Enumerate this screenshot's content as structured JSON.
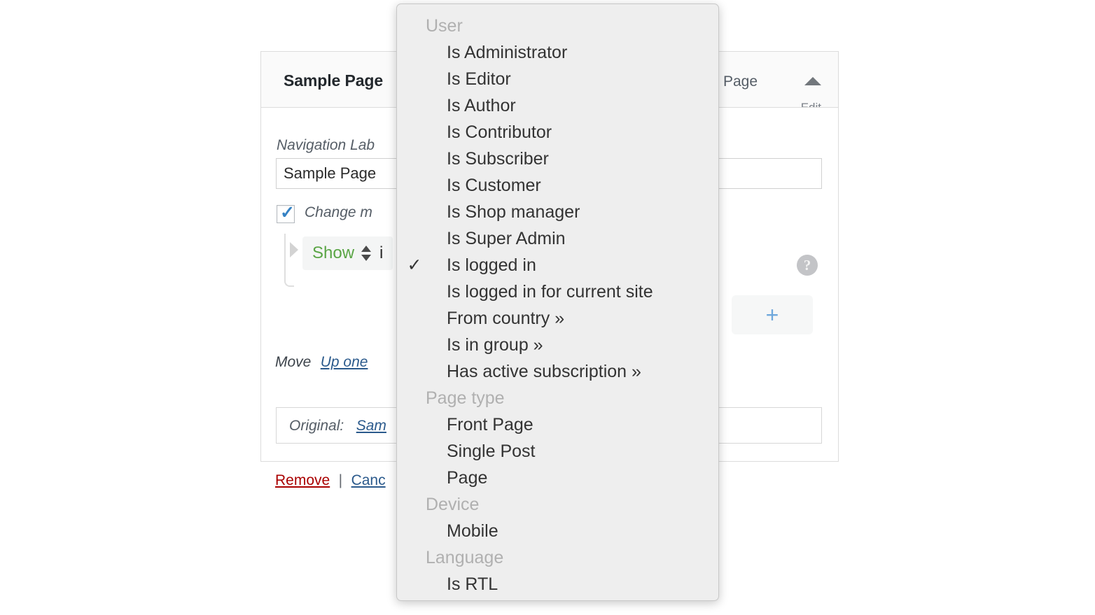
{
  "panel": {
    "header": {
      "title": "Sample Page",
      "type_label": "Page",
      "toggle_icon": "triangle-up-icon",
      "edit_clipped": "Edit"
    },
    "navigation_label": {
      "label": "Navigation Lab",
      "value": "Sample Page"
    },
    "change_menu": {
      "checked": true,
      "label": "Change m"
    },
    "condition_row": {
      "show_value": "Show",
      "stepper_icon": "up-down-arrows-icon",
      "if_text": "i",
      "help_icon": "question-mark-icon",
      "add_label": "+"
    },
    "move": {
      "label": "Move",
      "link": "Up one"
    },
    "original": {
      "label": "Original:",
      "link": "Sam"
    },
    "actions": {
      "remove": "Remove",
      "separator": "|",
      "cancel": "Canc"
    }
  },
  "dropdown": {
    "sections": [
      {
        "group": "User",
        "items": [
          {
            "label": "Is Administrator",
            "checked": false
          },
          {
            "label": "Is Editor",
            "checked": false
          },
          {
            "label": "Is Author",
            "checked": false
          },
          {
            "label": "Is Contributor",
            "checked": false
          },
          {
            "label": "Is Subscriber",
            "checked": false
          },
          {
            "label": "Is Customer",
            "checked": false
          },
          {
            "label": "Is Shop manager",
            "checked": false
          },
          {
            "label": "Is Super Admin",
            "checked": false
          },
          {
            "label": "Is logged in",
            "checked": true
          },
          {
            "label": "Is logged in for current site",
            "checked": false
          },
          {
            "label": "From country »",
            "checked": false
          },
          {
            "label": "Is in group »",
            "checked": false
          },
          {
            "label": "Has active subscription »",
            "checked": false
          }
        ]
      },
      {
        "group": "Page type",
        "items": [
          {
            "label": "Front Page",
            "checked": false
          },
          {
            "label": "Single Post",
            "checked": false
          },
          {
            "label": "Page",
            "checked": false
          }
        ]
      },
      {
        "group": "Device",
        "items": [
          {
            "label": "Mobile",
            "checked": false
          }
        ]
      },
      {
        "group": "Language",
        "items": [
          {
            "label": "Is RTL",
            "checked": false
          }
        ]
      }
    ],
    "check_glyph": "✓"
  }
}
